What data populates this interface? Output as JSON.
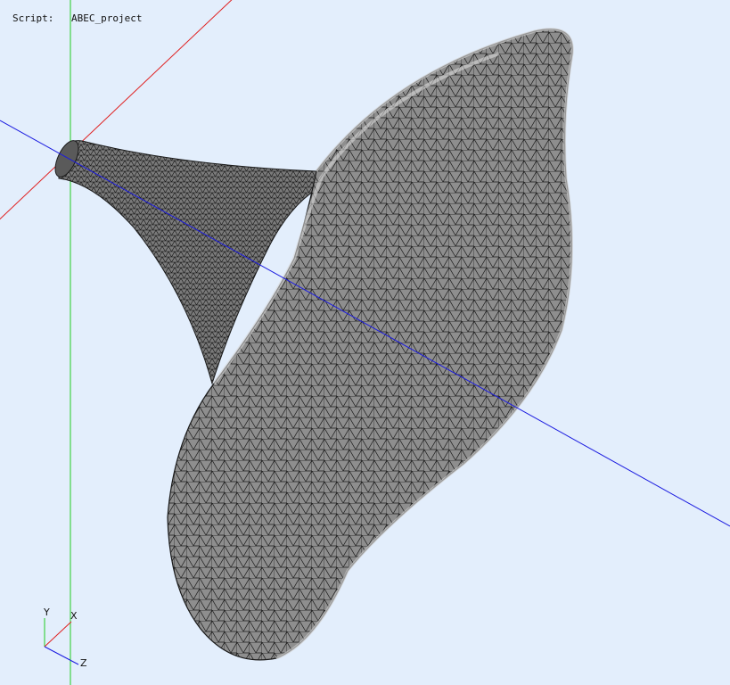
{
  "header": {
    "script_label": "Script:",
    "script_name": "ABEC_project"
  },
  "triad": {
    "y_label": "Y",
    "x_label": "X",
    "z_label": "Z"
  },
  "colors": {
    "background": "#e3eefc",
    "axis_x": "#e02020",
    "axis_y": "#22cc22",
    "axis_z": "#1a1ae0",
    "mesh_fill": "#8e8e8e",
    "mesh_lines": "#1a1a1a"
  },
  "icons": [
    "coordinate-triad-icon"
  ]
}
